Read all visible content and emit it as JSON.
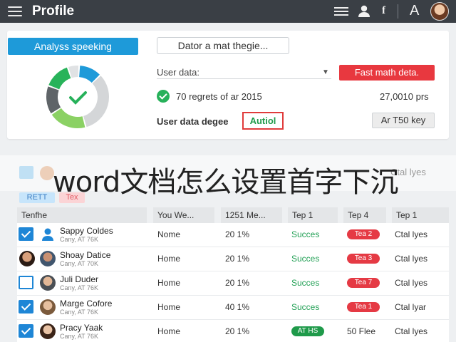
{
  "header": {
    "title": "Profile",
    "icons": [
      "menu-icon",
      "list-icon",
      "user-icon",
      "f-icon",
      "a-icon",
      "avatar"
    ],
    "f_glyph": "f",
    "a_glyph": "A"
  },
  "card": {
    "analysis_button": "Analyss speeking",
    "select_button": "Dator a mat thegie...",
    "user_data_label": "User data:",
    "red_button": "Fast math deta.",
    "reports_text": "70 regrets of ar 2015",
    "reports_value": "27,0010 prs",
    "degree_label": "User data degee",
    "degree_value": "Autiol",
    "key_button": "Ar T50 key",
    "donut_segments": [
      {
        "color": "#1e9ad9",
        "share": 0.12
      },
      {
        "color": "#d4d6d8",
        "share": 0.33
      },
      {
        "color": "#8bd164",
        "share": 0.2
      },
      {
        "color": "#5f6468",
        "share": 0.15
      },
      {
        "color": "#28b35a",
        "share": 0.14
      },
      {
        "color": "#e0e2e4",
        "share": 0.06
      }
    ],
    "accent": "#1e9ad9",
    "danger": "#e8383f",
    "success": "#27b15a"
  },
  "overlay": {
    "headline": "word文档怎么设置首字下沉",
    "right_text": "Ctal lyes",
    "pill_a": "RETT",
    "pill_b": "Tex"
  },
  "table": {
    "headers": [
      "Tenfhe",
      "You We...",
      "1251 Me...",
      "Tep 1",
      "Tep 4",
      "Tep 1"
    ],
    "rows": [
      {
        "name": "Sappy Coldes",
        "sub": "Cany, AT 76K",
        "c1": "Nome",
        "c2": "20 1%",
        "c3": "Succes",
        "c4": "Tea 2",
        "c5": "Ctal lyes"
      },
      {
        "name": "Shoay Datice",
        "sub": "Cany, AT 70K",
        "c1": "Home",
        "c2": "20 1%",
        "c3": "Succes",
        "c4": "Tea 3",
        "c5": "Ctal lyes"
      },
      {
        "name": "Juli Duder",
        "sub": "Cany, AT 76K",
        "c1": "Home",
        "c2": "20 1%",
        "c3": "Succes",
        "c4": "Tea 7",
        "c5": "Ctal lyes"
      },
      {
        "name": "Marge Cofore",
        "sub": "Cany, AT 76K",
        "c1": "Home",
        "c2": "40 1%",
        "c3": "Succes",
        "c4": "Tea 1",
        "c5": "Ctal lyar"
      },
      {
        "name": "Pracy Yaak",
        "sub": "Cany, AT 76K",
        "c1": "Home",
        "c2": "20 1%",
        "c3": "AT HS",
        "c4": "50 Flee",
        "c5": "Ctal lyes"
      }
    ]
  }
}
